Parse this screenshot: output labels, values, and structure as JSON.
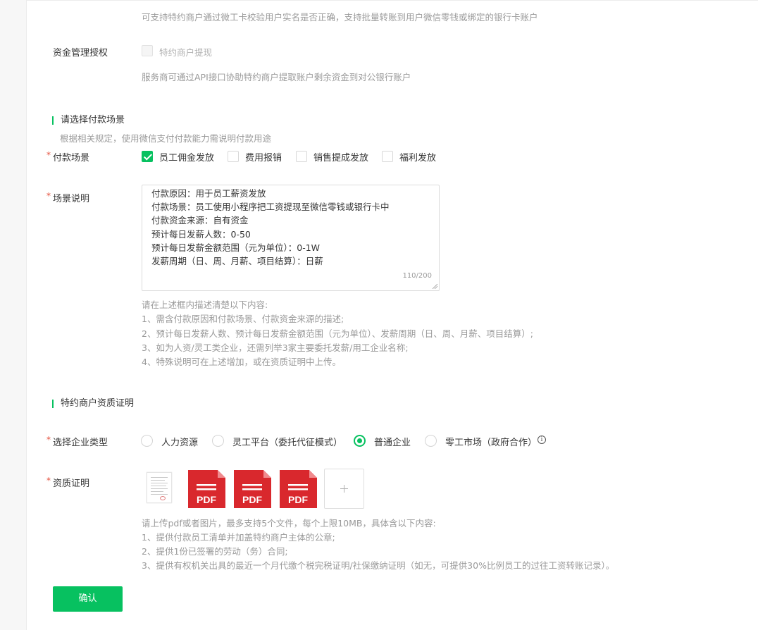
{
  "top_hint": "可支持特约商户通过微工卡校验用户实名是否正确，支持批量转账到用户微信零钱或绑定的银行卡账户",
  "fund_auth": {
    "label": "资金管理授权",
    "option": "特约商户提现",
    "hint": "服务商可通过API接口协助特约商户提取账户剩余资金到对公银行账户"
  },
  "payment_section": {
    "title": "请选择付款场景",
    "hint": "根据相关规定，使用微信支付付款能力需说明付款用途"
  },
  "payment_scene": {
    "label": "付款场景",
    "options": [
      {
        "label": "员工佣金发放",
        "checked": true
      },
      {
        "label": "费用报销",
        "checked": false
      },
      {
        "label": "销售提成发放",
        "checked": false
      },
      {
        "label": "福利发放",
        "checked": false
      }
    ]
  },
  "scene_desc": {
    "label": "场景说明",
    "lines": [
      "付款原因：用于员工薪资发放",
      "付款场景：员工使用小程序把工资提现至微信零钱或银行卡中",
      "付款资金来源：自有资金",
      "预计每日发薪人数：0-50",
      "预计每日发薪金额范围（元为单位）：0-1W",
      "发薪周期（日、周、月薪、项目结算）：日薪"
    ],
    "counter": "110/200",
    "help": [
      "请在上述框内描述清楚以下内容:",
      "1、需含付款原因和付款场景、付款资金来源的描述;",
      "2、预计每日发薪人数、预计每日发薪金额范围（元为单位）、发薪周期（日、周、月薪、项目结算）;",
      "3、如为人资/灵工类企业，还需列举3家主要委托发薪/用工企业名称;",
      "4、特殊说明可在上述增加，或在资质证明中上传。"
    ]
  },
  "qualification_section": {
    "title": "特约商户资质证明"
  },
  "enterprise_type": {
    "label": "选择企业类型",
    "options": [
      {
        "label": "人力资源",
        "checked": false
      },
      {
        "label": "灵工平台（委托代征模式）",
        "checked": false
      },
      {
        "label": "普通企业",
        "checked": true
      },
      {
        "label": "零工市场（政府合作）",
        "checked": false
      }
    ]
  },
  "qualification": {
    "label": "资质证明",
    "pdf_text": "PDF",
    "help": [
      "请上传pdf或者图片，最多支持5个文件，每个上限10MB，具体含以下内容:",
      "1、提供付款员工清单并加盖特约商户主体的公章;",
      "2、提供1份已签署的劳动（务）合同;",
      "3、提供有权机关出具的最近一个月代缴个税完税证明/社保缴纳证明（如无，可提供30%比例员工的过往工资转账记录）。"
    ]
  },
  "confirm_label": "确认",
  "colors": {
    "accent": "#07c160",
    "pdf_red": "#d9282d",
    "required": "#e5513e"
  }
}
